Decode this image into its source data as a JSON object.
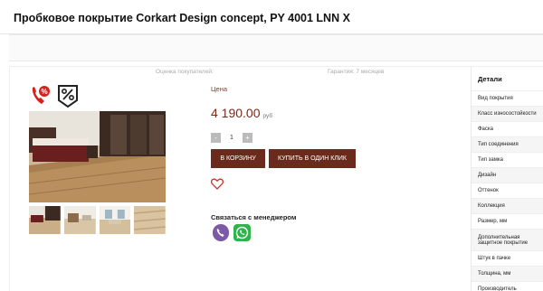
{
  "page": {
    "title": "Пробковое покрытие Corkart Design concept, PY 4001 LNN X"
  },
  "product": {
    "rating_label": "Оценка покупателей:",
    "warranty_label": "Гарантия: 7 месяцев",
    "price_label": "Цена",
    "price": "4 190.00",
    "currency": "руб",
    "quantity": "1",
    "qty_minus": "-",
    "qty_plus": "+",
    "cart_button": "В КОРЗИНУ",
    "oneclick_button": "КУПИТЬ В ОДИН КЛИК",
    "manager_label": "Связаться с менеджером"
  },
  "details": {
    "heading": "Детали",
    "rows": [
      "Вид покрытия",
      "Класс износостойкости",
      "Фаска",
      "Тип соединения",
      "Тип замка",
      "Дизайн",
      "Оттенок",
      "Коллекция",
      "Размер, мм",
      "Дополнительная защитное покрытие",
      "Штук в пачке",
      "Толщина, мм",
      "Производитель"
    ]
  },
  "colors": {
    "accent": "#6b2b1c",
    "price": "#7a2a1a",
    "viber": "#7d5aa6",
    "whatsapp": "#2fb34a"
  }
}
